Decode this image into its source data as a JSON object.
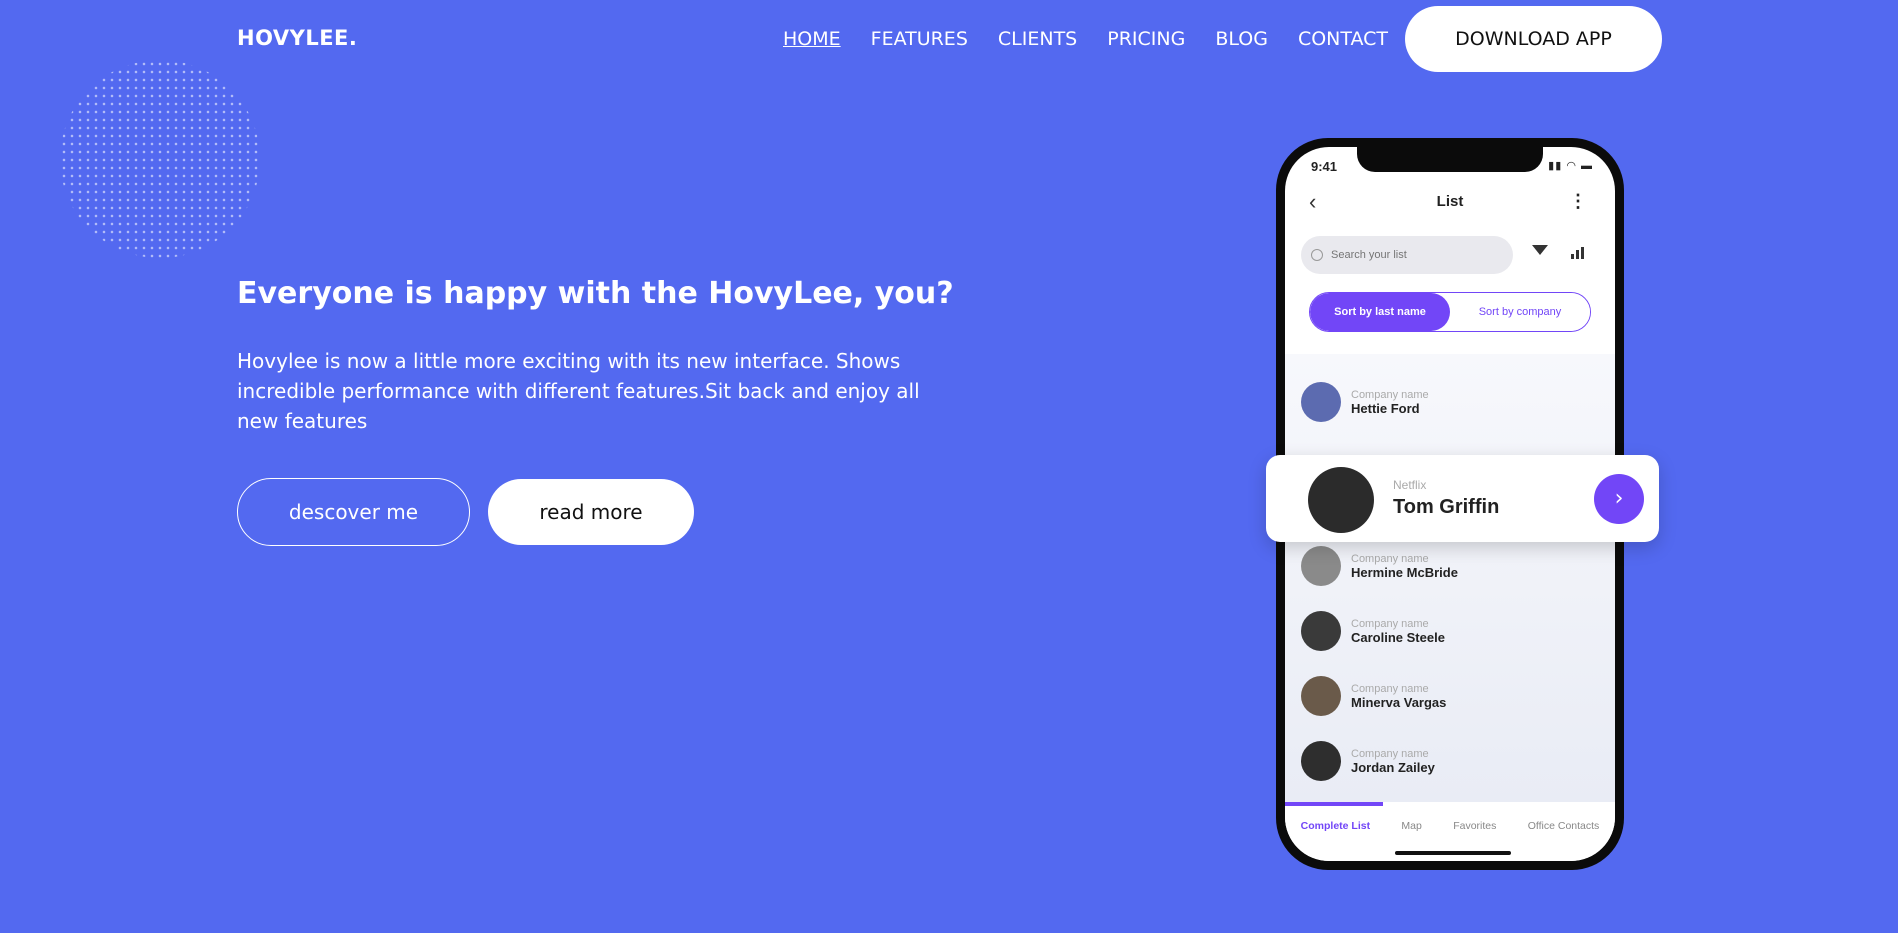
{
  "brand": {
    "logo": "HOVYLEE."
  },
  "nav": {
    "items": [
      "HOME",
      "FEATURES",
      "CLIENTS",
      "PRICING",
      "BLOG",
      "CONTACT"
    ],
    "download": "DOWNLOAD APP"
  },
  "hero": {
    "title": "Everyone is happy with the HovyLee, you?",
    "description": "Hovylee is now a little more exciting with its new interface. Shows incredible performance with different features.Sit back and enjoy all new features",
    "primary_button": "descover me",
    "secondary_button": "read more"
  },
  "phone": {
    "time": "9:41",
    "title": "List",
    "search_placeholder": "Search your list",
    "sort_options": [
      "Sort by last name",
      "Sort by company"
    ],
    "list": [
      {
        "company": "Company name",
        "name": "Hettie Ford"
      },
      {
        "company": "Company name",
        "name": "Hermine McBride"
      },
      {
        "company": "Company name",
        "name": "Caroline Steele"
      },
      {
        "company": "Company name",
        "name": "Minerva Vargas"
      },
      {
        "company": "Company name",
        "name": "Jordan Zailey"
      }
    ],
    "featured": {
      "company": "Netflix",
      "name": "Tom Griffin"
    },
    "tabs": [
      "Complete List",
      "Map",
      "Favorites",
      "Office Contacts"
    ]
  },
  "colors": {
    "background": "#5369f0",
    "accent": "#7246f7"
  },
  "icons": [
    "back-arrow-icon",
    "more-vert-icon",
    "search-icon",
    "filter-icon",
    "bar-chart-icon",
    "chevron-right-icon"
  ]
}
